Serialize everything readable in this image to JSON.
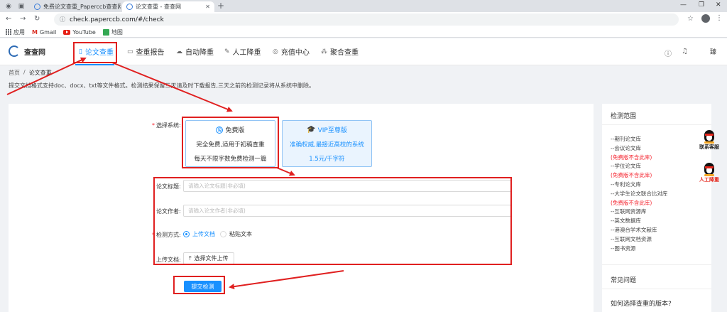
{
  "browser": {
    "tabs": [
      {
        "title": "免费论文查重_Paperccb查查网论"
      },
      {
        "title": "论文查重 - 查查网"
      }
    ],
    "url": "check.paperccb.com/#/check",
    "bookmarks": [
      "应用",
      "Gmail",
      "YouTube",
      "地图"
    ]
  },
  "header": {
    "logo_text": "查查网",
    "nav": [
      "论文查重",
      "查重报告",
      "自动降重",
      "人工降重",
      "充值中心",
      "聚合查重"
    ],
    "user": "臻"
  },
  "breadcrumb": {
    "home": "首页",
    "sep": "/",
    "current": "论文查重"
  },
  "notice": "提交文档格式支持doc、docx、txt等文件格式。检测结果保留三天请及时下载报告,三天之前的检测记录将从系统中删除。",
  "form": {
    "system_label": "选择系统:",
    "free": {
      "title": "免费版",
      "line1": "完全免费,适用于初稿查重",
      "line2": "每天不限字数免费检测一篇"
    },
    "vip": {
      "title": "VIP至尊版",
      "line1": "准确权威,最接近高校的系统",
      "line2": "1.5元/千字符"
    },
    "title_label": "论文标题:",
    "title_placeholder": "请输入论文标题(非必填)",
    "author_label": "论文作者:",
    "author_placeholder": "请输入论文作者(非必填)",
    "method_label": "检测方式:",
    "method_options": [
      "上传文档",
      "粘贴文本"
    ],
    "method_selected": "上传文档",
    "upload_label": "上传文档:",
    "upload_button": "选择文件上传",
    "submit": "提交检测"
  },
  "sidebar": {
    "scope_title": "检测范围",
    "scope_items": [
      {
        "text": "--期刊论文库",
        "red": false
      },
      {
        "text": "--会议论文库",
        "red": false
      },
      {
        "text": "(免费版不含此库)",
        "red": true
      },
      {
        "text": "--学位论文库",
        "red": false
      },
      {
        "text": "(免费版不含此库)",
        "red": true
      },
      {
        "text": "--专利论文库",
        "red": false
      },
      {
        "text": "--大学生论文联合比对库",
        "red": false
      },
      {
        "text": "(免费版不含此库)",
        "red": true
      },
      {
        "text": "--互联网资源库",
        "red": false
      },
      {
        "text": "--英文数据库",
        "red": false
      },
      {
        "text": "--港澳台学术文献库",
        "red": false
      },
      {
        "text": "--互联网文档资源",
        "red": false
      },
      {
        "text": "--图书资源",
        "red": false
      }
    ],
    "faq_title": "常见问题",
    "faq_item": "如何选择查重的版本?"
  },
  "floating": {
    "qq1": "联系客服",
    "qq2": "人工降重"
  }
}
